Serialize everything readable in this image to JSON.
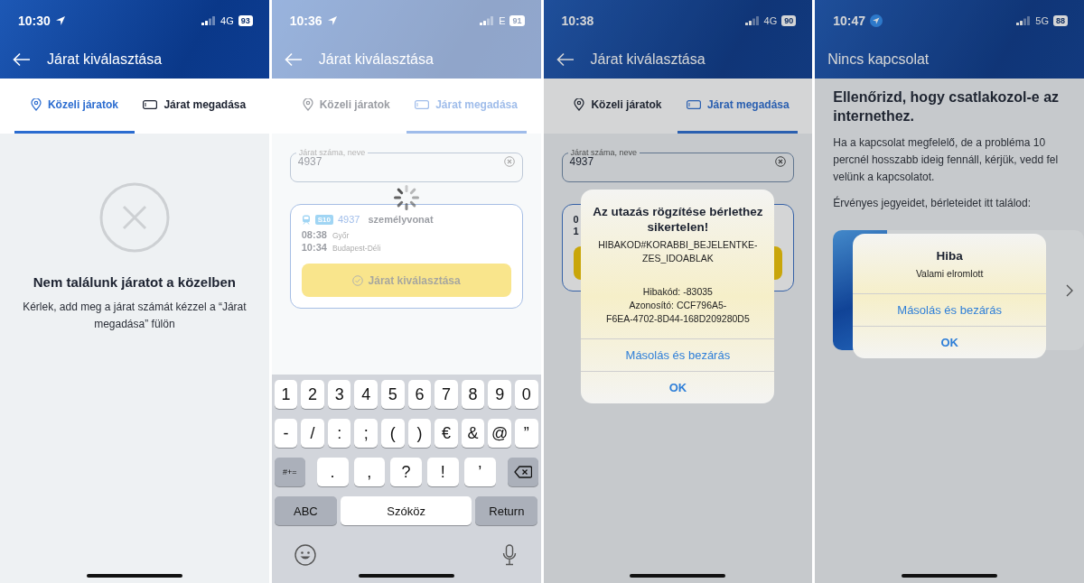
{
  "screens": [
    {
      "status_bar": {
        "time": "10:30",
        "location": {
          "kind": "arrow"
        },
        "network": "4G",
        "battery": "93"
      },
      "header": {
        "title": "Járat kiválasztása",
        "back_button": true
      },
      "tabs": [
        {
          "label": "Közeli járatok",
          "selected": true
        },
        {
          "label": "Járat megadása",
          "selected": false
        }
      ],
      "content": {
        "kind": "empty",
        "title": "Nem találunk járatot a közelben",
        "message": "Kérlek, add meg a járat számát kézzel a “Járat megadása” fülön"
      }
    },
    {
      "status_bar": {
        "time": "10:36",
        "location": {
          "kind": "arrow"
        },
        "network": "E",
        "battery": "91"
      },
      "header": {
        "title": "Járat kiválasztása",
        "back_button": true
      },
      "tabs": [
        {
          "label": "Közeli járatok",
          "selected": false
        },
        {
          "label": "Járat megadása",
          "selected": true
        }
      ],
      "content": {
        "kind": "search",
        "field": {
          "label": "Járat száma, neve",
          "value": "4937"
        },
        "card": {
          "badge": "S10",
          "number": "4937",
          "type": "személyvonat",
          "stops": [
            {
              "time": "08:38",
              "station": "Győr"
            },
            {
              "time": "10:34",
              "station": "Budapest-Déli"
            }
          ],
          "button": "Járat kiválasztása"
        }
      },
      "overlay": {
        "kind": "loading"
      },
      "keyboard": {
        "rows": [
          {
            "keys": [
              {
                "kind": "char",
                "label": "1"
              },
              {
                "kind": "char",
                "label": "2"
              },
              {
                "kind": "char",
                "label": "3"
              },
              {
                "kind": "char",
                "label": "4"
              },
              {
                "kind": "char",
                "label": "5"
              },
              {
                "kind": "char",
                "label": "6"
              },
              {
                "kind": "char",
                "label": "7"
              },
              {
                "kind": "char",
                "label": "8"
              },
              {
                "kind": "char",
                "label": "9"
              },
              {
                "kind": "char",
                "label": "0"
              }
            ]
          },
          {
            "keys": [
              {
                "kind": "char",
                "label": "-"
              },
              {
                "kind": "char",
                "label": "/"
              },
              {
                "kind": "char",
                "label": ":"
              },
              {
                "kind": "char",
                "label": ";"
              },
              {
                "kind": "char",
                "label": "("
              },
              {
                "kind": "char",
                "label": ")"
              },
              {
                "kind": "char",
                "label": "€"
              },
              {
                "kind": "char",
                "label": "&"
              },
              {
                "kind": "char",
                "label": "@"
              },
              {
                "kind": "char",
                "label": "”"
              }
            ]
          },
          {
            "keys": [
              {
                "kind": "mod",
                "label": "#+="
              },
              {
                "kind": "wide",
                "label": "."
              },
              {
                "kind": "wide",
                "label": ","
              },
              {
                "kind": "wide",
                "label": "?"
              },
              {
                "kind": "wide",
                "label": "!"
              },
              {
                "kind": "wide",
                "label": "’"
              },
              {
                "kind": "backspace"
              }
            ]
          },
          {
            "keys": [
              {
                "kind": "mod",
                "label": "ABC"
              },
              {
                "kind": "space",
                "label": "Szóköz"
              },
              {
                "kind": "mod",
                "label": "Return"
              }
            ]
          }
        ]
      }
    },
    {
      "status_bar": {
        "time": "10:38",
        "network": "4G",
        "battery": "90"
      },
      "header": {
        "title": "Járat kiválasztása",
        "back_button": true
      },
      "tabs": [
        {
          "label": "Közeli járatok",
          "selected": false
        },
        {
          "label": "Járat megadása",
          "selected": true
        }
      ],
      "content": {
        "kind": "search",
        "field": {
          "label": "Járat száma, neve",
          "value": "4937"
        },
        "card": {
          "stops": [
            {
              "time": "0"
            },
            {
              "time": "1"
            }
          ]
        }
      },
      "overlay": {
        "kind": "dim"
      },
      "alert": {
        "title": "Az utazás rögzítése bérlethez sikertelen!",
        "paragraphs": [
          [
            "HIBAKOD#KORABBI_BEJELENTKE-",
            "ZES_IDOABLAK"
          ],
          [
            "Hibakód: -83035",
            "Azonosító: CCF796A5-",
            "F6EA-4702-8D44-168D209280D5"
          ]
        ],
        "buttons": [
          {
            "label": "Másolás és bezárás",
            "kind": "plain"
          },
          {
            "label": "OK",
            "kind": "default"
          }
        ]
      }
    },
    {
      "status_bar": {
        "time": "10:47",
        "location": {
          "kind": "arrow-circled"
        },
        "network": "5G",
        "battery": "88"
      },
      "header": {
        "title": "Nincs kapcsolat",
        "back_button": false
      },
      "content": {
        "kind": "offline",
        "title": "Ellenőrizd, hogy csatlakozol-e az internethez.",
        "paragraphs": [
          "Ha a kapcsolat megfelelő, de a probléma 10 percnél hosszabb ideig fennáll, kérjük, vedd fel velünk a kapcsolatot.",
          "Érvényes jegyeidet, bérleteidet itt találod:"
        ]
      },
      "overlay": {
        "kind": "dim"
      },
      "alert": {
        "title": "Hiba",
        "paragraphs": [
          [
            "Valami elromlott"
          ]
        ],
        "buttons": [
          {
            "label": "Másolás és bezárás",
            "kind": "plain"
          },
          {
            "label": "OK",
            "kind": "default"
          }
        ]
      }
    }
  ]
}
